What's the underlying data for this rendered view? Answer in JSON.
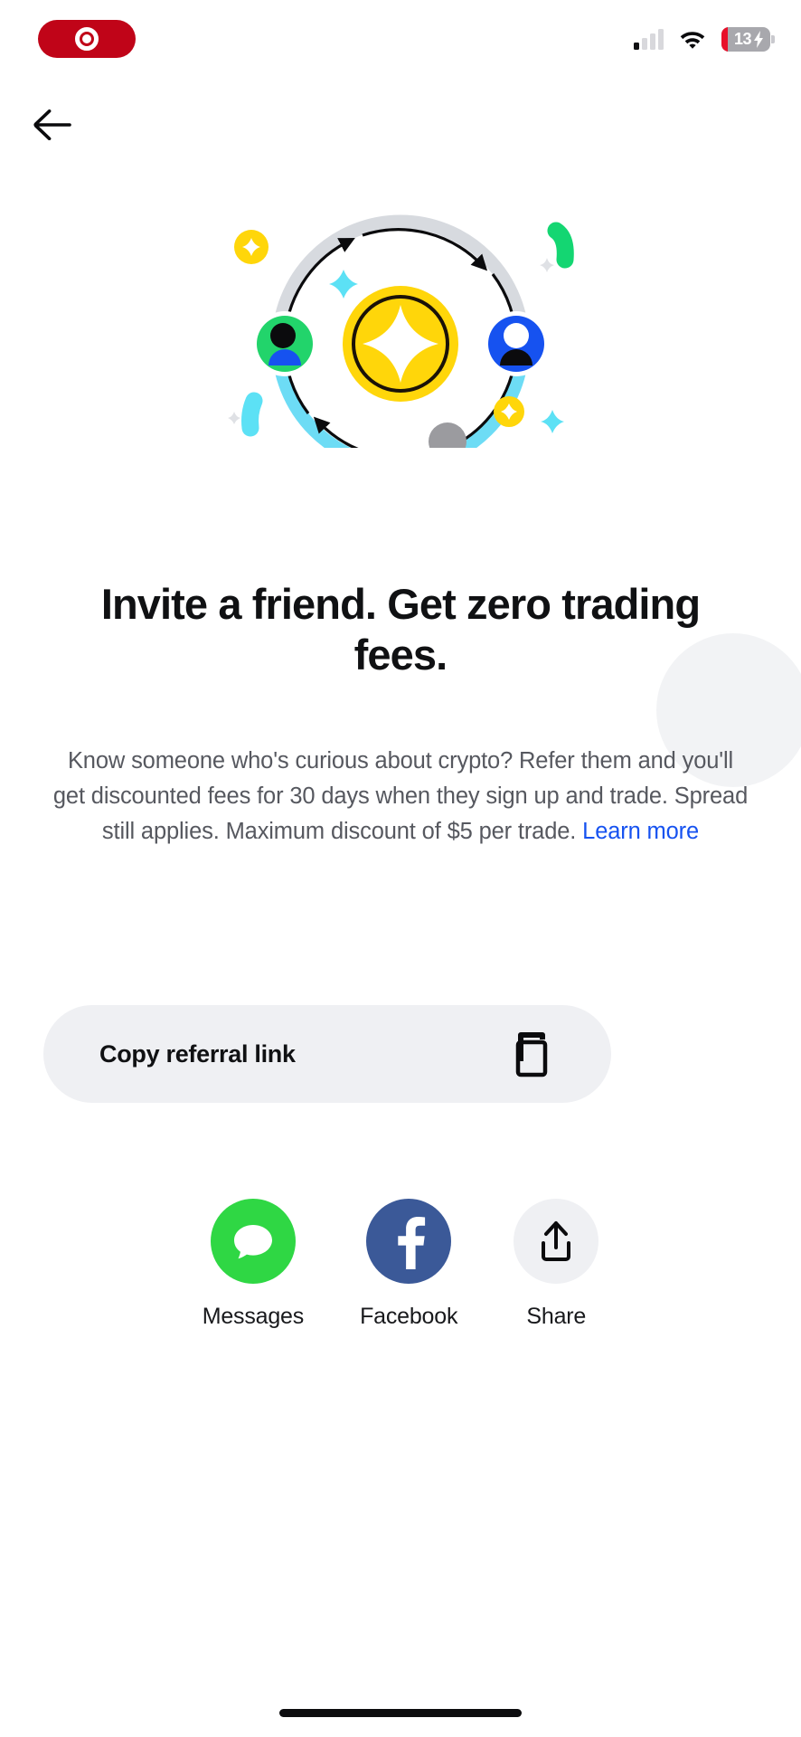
{
  "status_bar": {
    "recording_indicator": "recording-pill",
    "signal_icon": "cellular-signal-icon",
    "signal_bars_filled": 1,
    "signal_bars_total": 4,
    "wifi_icon": "wifi-icon",
    "battery_icon": "battery-charging-icon",
    "battery_percent": "13",
    "battery_charging": true,
    "battery_fill_color": "#e8102a"
  },
  "nav": {
    "back_icon": "arrow-left-icon",
    "back_label": "Back"
  },
  "illustration": {
    "name": "referral-orbit-illustration",
    "coin_color": "#FFD60A",
    "coin_ring_color": "#1a1208",
    "outer_arc_color": "#d7dadf",
    "inner_arc_color": "#6ddcf5",
    "avatar_left_color": "#22d46b",
    "avatar_right_color": "#1652f0",
    "accent_yellow": "#FFD60A",
    "accent_cyan": "#5CE1F5",
    "accent_green": "#14d672",
    "accent_gray": "#9b9b9f"
  },
  "headline": "Invite a friend. Get zero trading fees.",
  "body": {
    "text": "Know someone who's curious about crypto? Refer them and you'll get discounted fees for 30 days when they sign up and trade. Spread still applies. Maximum discount of $5 per trade. ",
    "link_label": "Learn more",
    "link_color": "#1652f0"
  },
  "copy_button": {
    "label": "Copy referral link",
    "icon": "copy-icon",
    "background": "#eff0f3"
  },
  "share_options": [
    {
      "label": "Messages",
      "icon": "messages-bubble-icon",
      "color": "#2fd744"
    },
    {
      "label": "Facebook",
      "icon": "facebook-f-icon",
      "color": "#3b5998"
    },
    {
      "label": "Share",
      "icon": "share-upload-icon",
      "color": "#eff0f3"
    }
  ],
  "home_indicator": "home-indicator-bar"
}
